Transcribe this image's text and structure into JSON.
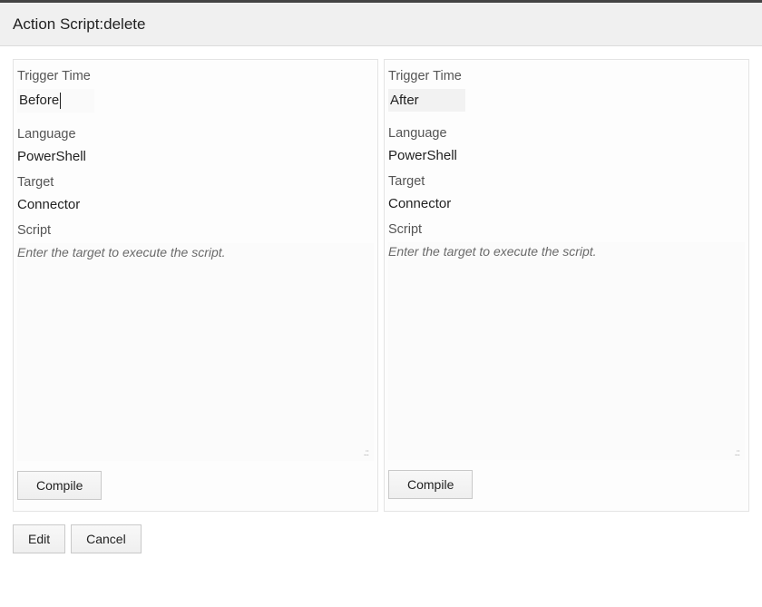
{
  "header": {
    "title": "Action Script:delete"
  },
  "panels": {
    "left": {
      "trigger_time_label": "Trigger Time",
      "trigger_time_value": "Before",
      "language_label": "Language",
      "language_value": "PowerShell",
      "target_label": "Target",
      "target_value": "Connector",
      "script_label": "Script",
      "script_placeholder": "Enter the target to execute the script.",
      "compile_label": "Compile"
    },
    "right": {
      "trigger_time_label": "Trigger Time",
      "trigger_time_value": "After",
      "language_label": "Language",
      "language_value": "PowerShell",
      "target_label": "Target",
      "target_value": "Connector",
      "script_label": "Script",
      "script_placeholder": "Enter the target to execute the script.",
      "compile_label": "Compile"
    }
  },
  "footer": {
    "edit_label": "Edit",
    "cancel_label": "Cancel"
  }
}
